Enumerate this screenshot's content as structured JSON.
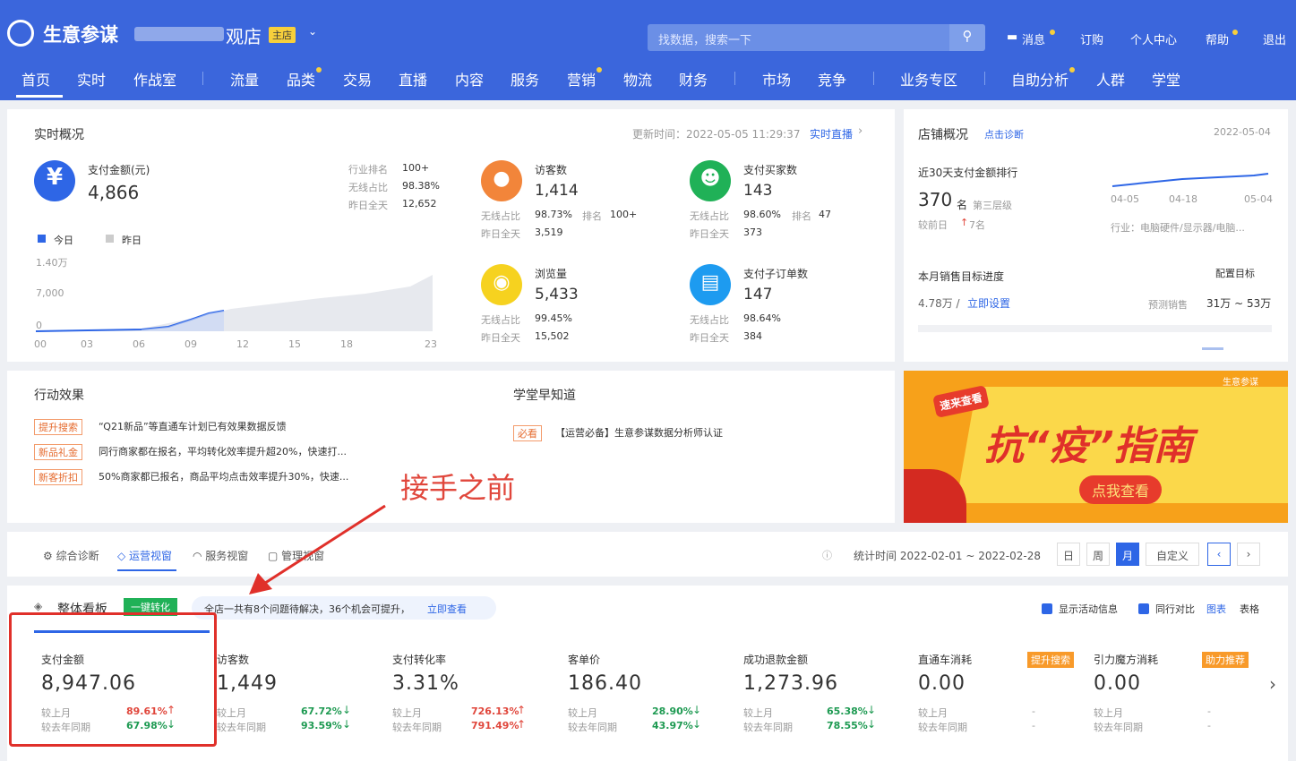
{
  "header": {
    "brand": "生意参谋",
    "shop_suffix": "观店",
    "main_shop_tag": "主店",
    "search_placeholder": "找数据，搜索一下",
    "links": [
      "消息",
      "订购",
      "个人中心",
      "帮助",
      "退出"
    ]
  },
  "nav": [
    "首页",
    "实时",
    "作战室",
    "流量",
    "品类",
    "交易",
    "直播",
    "内容",
    "服务",
    "营销",
    "物流",
    "财务",
    "市场",
    "竞争",
    "业务专区",
    "自助分析",
    "人群",
    "学堂"
  ],
  "realtime": {
    "title": "实时概况",
    "update_label": "更新时间：2022-05-05 11:29:37",
    "live_link": "实时直播",
    "pay": {
      "label": "支付金额(元)",
      "value": "4,866",
      "rank_k": "行业排名",
      "rank_v": "100+",
      "wireless_k": "无线占比",
      "wireless_v": "98.38%",
      "yday_k": "昨日全天",
      "yday_v": "12,652"
    },
    "legend": {
      "today": "今日",
      "yesterday": "昨日"
    },
    "yticks": [
      "1.40万",
      "7,000",
      "0"
    ],
    "xticks": [
      "00",
      "03",
      "06",
      "09",
      "12",
      "15",
      "18",
      "23"
    ],
    "visitors": {
      "label": "访客数",
      "value": "1,414",
      "wk": "无线占比",
      "wv": "98.73%",
      "rk": "排名",
      "rv": "100+",
      "yk": "昨日全天",
      "yv": "3,519"
    },
    "buyers": {
      "label": "支付买家数",
      "value": "143",
      "wk": "无线占比",
      "wv": "98.60%",
      "rk": "排名",
      "rv": "47",
      "yk": "昨日全天",
      "yv": "373"
    },
    "views": {
      "label": "浏览量",
      "value": "5,433",
      "wk": "无线占比",
      "wv": "99.45%",
      "yk": "昨日全天",
      "yv": "15,502"
    },
    "suborders": {
      "label": "支付子订单数",
      "value": "147",
      "wk": "无线占比",
      "wv": "98.64%",
      "yk": "昨日全天",
      "yv": "384"
    }
  },
  "shop": {
    "title": "店铺概况",
    "diag": "点击诊断",
    "date": "2022-05-04",
    "rank_title": "近30天支付金额排行",
    "rank": "370",
    "rank_unit": "名",
    "level": "第三层级",
    "vs": "较前日",
    "vs_val": "7名",
    "dates": [
      "04-05",
      "04-18",
      "05-04"
    ],
    "industry": "行业：电脑硬件/显示器/电脑...",
    "target_title": "本月销售目标进度",
    "config": "配置目标",
    "amount": "4.78万 /",
    "set": "立即设置",
    "forecast_k": "预测销售",
    "forecast_v": "31万 ~ 53万"
  },
  "action": {
    "title": "行动效果",
    "items": [
      {
        "tag": "提升搜索",
        "text": "“Q21新品”等直通车计划已有效果数据反馈"
      },
      {
        "tag": "新品礼金",
        "text": "同行商家都在报名，平均转化效率提升超20%，快速打..."
      },
      {
        "tag": "新客折扣",
        "text": "50%商家都已报名，商品平均点击效率提升30%，快速..."
      }
    ]
  },
  "academy": {
    "title": "学堂早知道",
    "tag": "必看",
    "text": "【运营必备】生意参谋数据分析师认证"
  },
  "annotation": "接手之前",
  "banner": {
    "badge": "速来查看",
    "title": "抗“疫”指南",
    "btn": "点我查看",
    "logo": "生意参谋"
  },
  "tabs": [
    "综合诊断",
    "运营视窗",
    "服务视窗",
    "管理视窗"
  ],
  "stat_time": "统计时间 2022-02-01 ~ 2022-02-28",
  "period": [
    "日",
    "周",
    "月",
    "自定义"
  ],
  "board": {
    "title": "整体看板",
    "btn": "一键转化",
    "notice": "全店一共有8个问题待解决，36个机会可提升，",
    "notice_link": "立即查看",
    "show_activity": "显示活动信息",
    "peer": "同行对比",
    "chart": "图表",
    "table": "表格"
  },
  "metrics": [
    {
      "label": "支付金额",
      "value": "8,947.06",
      "m1": "较上月",
      "v1": "89.61%",
      "d1": "up",
      "m2": "较去年同期",
      "v2": "67.98%",
      "d2": "down"
    },
    {
      "label": "访客数",
      "value": "1,449",
      "m1": "较上月",
      "v1": "67.72%",
      "d1": "down",
      "m2": "较去年同期",
      "v2": "93.59%",
      "d2": "down"
    },
    {
      "label": "支付转化率",
      "value": "3.31%",
      "m1": "较上月",
      "v1": "726.13%",
      "d1": "up",
      "m2": "较去年同期",
      "v2": "791.49%",
      "d2": "up"
    },
    {
      "label": "客单价",
      "value": "186.40",
      "m1": "较上月",
      "v1": "28.90%",
      "d1": "down",
      "m2": "较去年同期",
      "v2": "43.97%",
      "d2": "down"
    },
    {
      "label": "成功退款金额",
      "value": "1,273.96",
      "m1": "较上月",
      "v1": "65.38%",
      "d1": "down",
      "m2": "较去年同期",
      "v2": "78.55%",
      "d2": "down"
    },
    {
      "label": "直通车消耗",
      "value": "0.00",
      "tag": "提升搜索",
      "m1": "较上月",
      "v1": "-",
      "m2": "较去年同期",
      "v2": "-"
    },
    {
      "label": "引力魔方消耗",
      "value": "0.00",
      "tag": "助力推荐",
      "m1": "较上月",
      "v1": "-",
      "m2": "较去年同期",
      "v2": "-"
    }
  ]
}
